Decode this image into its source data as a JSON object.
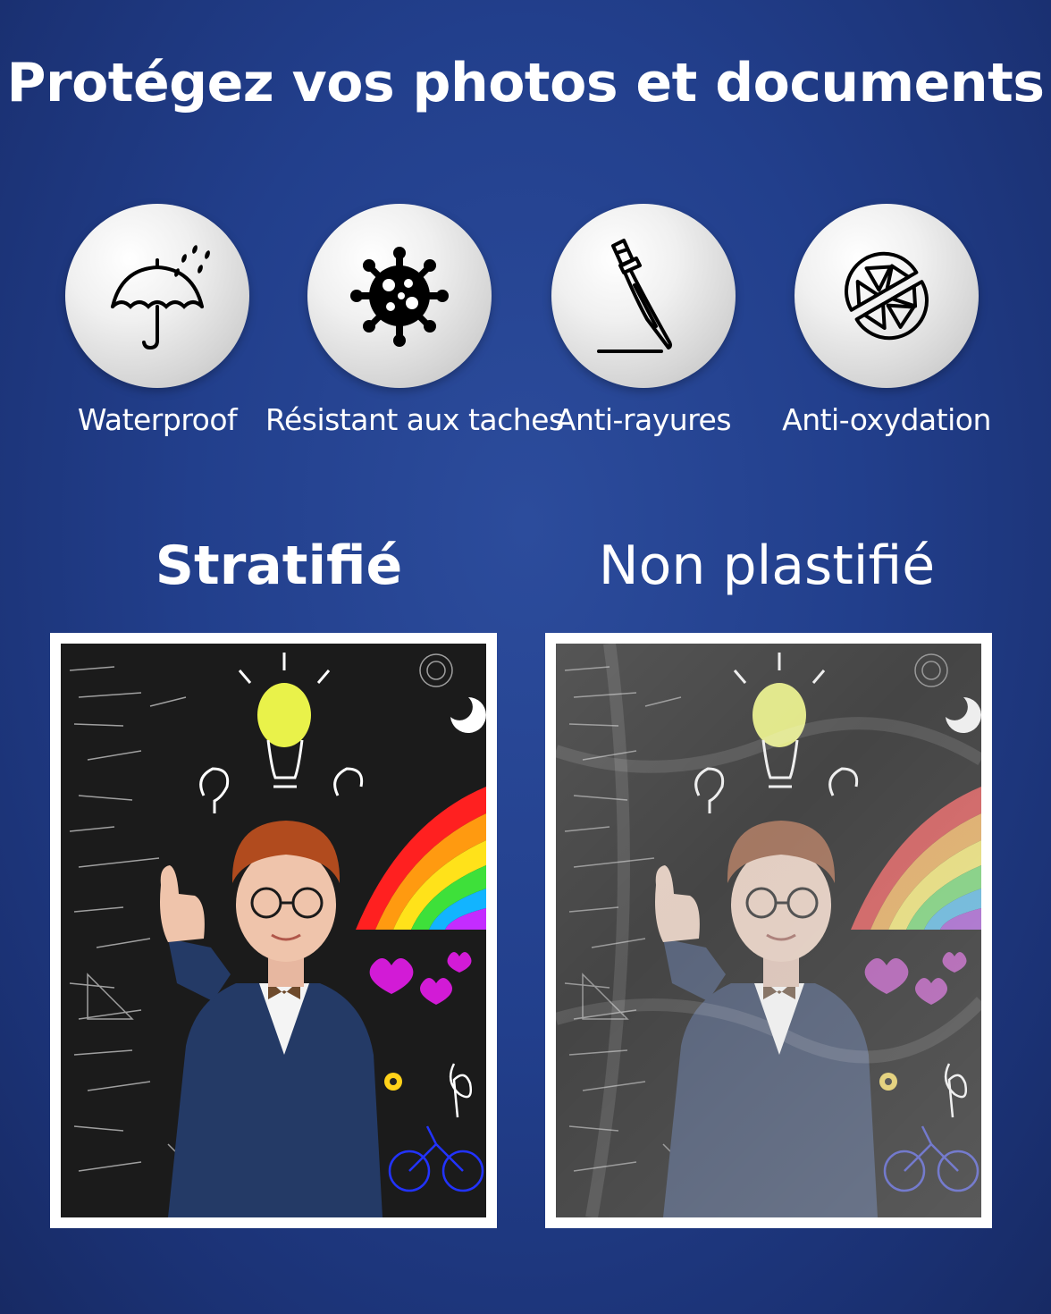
{
  "headline": "Protégez vos photos et documents",
  "features": [
    {
      "label": "Waterproof",
      "icon": "umbrella-rain-icon"
    },
    {
      "label": "Résistant aux taches",
      "icon": "stain-splat-icon"
    },
    {
      "label": "Anti-rayures",
      "icon": "knife-scratch-icon"
    },
    {
      "label": "Anti-oxydation",
      "icon": "no-lemon-icon"
    }
  ],
  "comparison": {
    "left_title": "Stratifié",
    "right_title": "Non plastifié"
  },
  "colors": {
    "background": "#223f8c",
    "text": "#ffffff",
    "icon_circle": "#e6e6e6"
  }
}
